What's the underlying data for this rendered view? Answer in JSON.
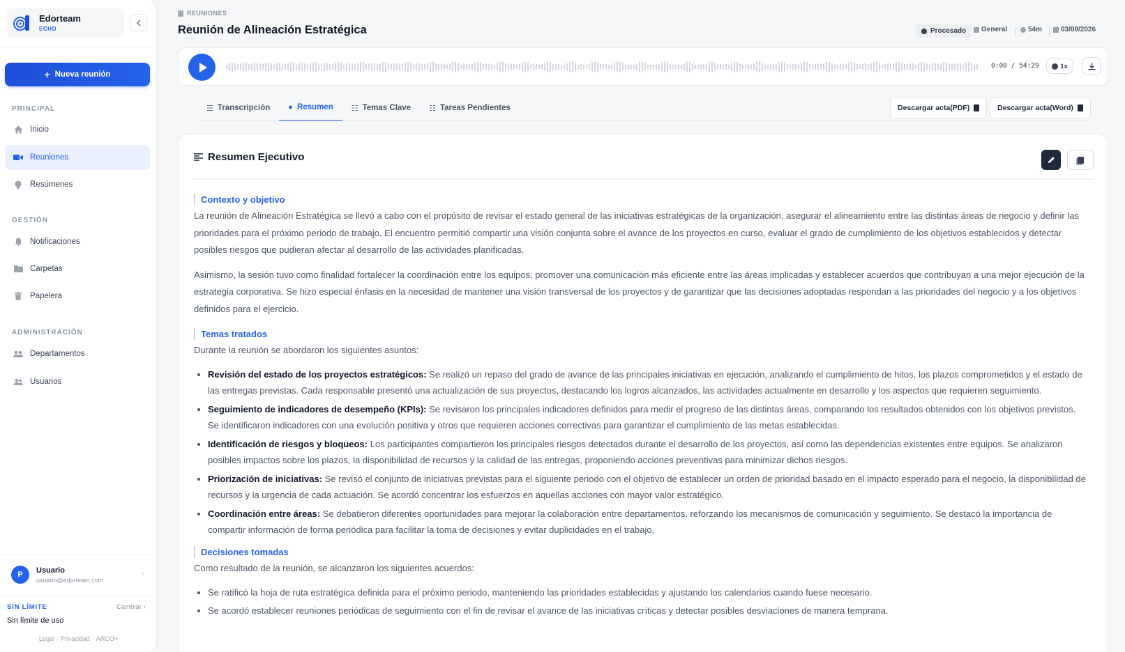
{
  "brand": {
    "name": "Edorteam",
    "sub": "ECHO"
  },
  "sidebar": {
    "new_meeting": "Nueva reunión",
    "sections": {
      "principal": "PRINCIPAL",
      "gestion": "GESTIÓN",
      "admin": "ADMINISTRACIÓN"
    },
    "items": {
      "inicio": "Inicio",
      "reuniones": "Reuniones",
      "resumenes": "Resúmenes",
      "notificaciones": "Notificaciones",
      "carpetas": "Carpetas",
      "papelera": "Papelera",
      "departamentos": "Departamentos",
      "usuarios": "Usuarios"
    },
    "user": {
      "initial": "P",
      "name": "Usuario",
      "email": "usuario@edorteam.com"
    },
    "plan": {
      "label": "SIN LÍMITE",
      "change": "Cambiar",
      "desc": "Sin límite de uso"
    },
    "footer": {
      "legal": "Legal",
      "privacy": "Privacidad",
      "arco": "ARCO+"
    }
  },
  "header": {
    "breadcrumb": "REUNIONES",
    "title": "Reunión de Alineación Estratégica",
    "status": "Procesado",
    "folder": "General",
    "duration": "54m",
    "date": "03/08/2026"
  },
  "player": {
    "time": "0:00 / 54:29",
    "speed": "1x"
  },
  "tabs": {
    "transcripcion": "Transcripción",
    "resumen": "Resumen",
    "temas": "Temas Clave",
    "tareas": "Tareas Pendientes"
  },
  "downloads": {
    "pdf": "Descargar acta(PDF)",
    "word": "Descargar acta(Word)"
  },
  "summary": {
    "title": "Resumen Ejecutivo",
    "s1_title": "Contexto y objetivo",
    "s1_p1": "La reunión de Alineación Estratégica se llevó a cabo con el propósito de revisar el estado general de las iniciativas estratégicas de la organización, asegurar el alineamiento entre las distintas áreas de negocio y definir las prioridades para el próximo periodo de trabajo. El encuentro permitió compartir una visión conjunta sobre el avance de los proyectos en curso, evaluar el grado de cumplimiento de los objetivos establecidos y detectar posibles riesgos que pudieran afectar al desarrollo de las actividades planificadas.",
    "s1_p2": "Asimismo, la sesión tuvo como finalidad fortalecer la coordinación entre los equipos, promover una comunicación más eficiente entre las áreas implicadas y establecer acuerdos que contribuyan a una mejor ejecución de la estrategia corporativa. Se hizo especial énfasis en la necesidad de mantener una visión transversal de los proyectos y de garantizar que las decisiones adoptadas respondan a las prioridades del negocio y a los objetivos definidos para el ejercicio.",
    "s2_title": "Temas tratados",
    "s2_intro": "Durante la reunión se abordaron los siguientes asuntos:",
    "topics": [
      {
        "bold": "Revisión del estado de los proyectos estratégicos:",
        "text": " Se realizó un repaso del grado de avance de las principales iniciativas en ejecución, analizando el cumplimiento de hitos, los plazos comprometidos y el estado de las entregas previstas. Cada responsable presentó una actualización de sus proyectos, destacando los logros alcanzados, las actividades actualmente en desarrollo y los aspectos que requieren seguimiento."
      },
      {
        "bold": "Seguimiento de indicadores de desempeño (KPIs):",
        "text": " Se revisaron los principales indicadores definidos para medir el progreso de las distintas áreas, comparando los resultados obtenidos con los objetivos previstos. Se identificaron indicadores con una evolución positiva y otros que requieren acciones correctivas para garantizar el cumplimiento de las metas establecidas."
      },
      {
        "bold": "Identificación de riesgos y bloqueos:",
        "text": " Los participantes compartieron los principales riesgos detectados durante el desarrollo de los proyectos, así como las dependencias existentes entre equipos. Se analizaron posibles impactos sobre los plazos, la disponibilidad de recursos y la calidad de las entregas, proponiendo acciones preventivas para minimizar dichos riesgos."
      },
      {
        "bold": "Priorización de iniciativas:",
        "text": " Se revisó el conjunto de iniciativas previstas para el siguiente periodo con el objetivo de establecer un orden de prioridad basado en el impacto esperado para el negocio, la disponibilidad de recursos y la urgencia de cada actuación. Se acordó concentrar los esfuerzos en aquellas acciones con mayor valor estratégico."
      },
      {
        "bold": "Coordinación entre áreas:",
        "text": " Se debatieron diferentes oportunidades para mejorar la colaboración entre departamentos, reforzando los mecanismos de comunicación y seguimiento. Se destacó la importancia de compartir información de forma periódica para facilitar la toma de decisiones y evitar duplicidades en el trabajo."
      }
    ],
    "s3_title": "Decisiones tomadas",
    "s3_intro": "Como resultado de la reunión, se alcanzaron los siguientes acuerdos:",
    "decisions": [
      "Se ratificó la hoja de ruta estratégica definida para el próximo periodo, manteniendo las prioridades establecidas y ajustando los calendarios cuando fuese necesario.",
      "Se acordó establecer reuniones periódicas de seguimiento con el fin de revisar el avance de las iniciativas críticas y detectar posibles desviaciones de manera temprana."
    ]
  }
}
